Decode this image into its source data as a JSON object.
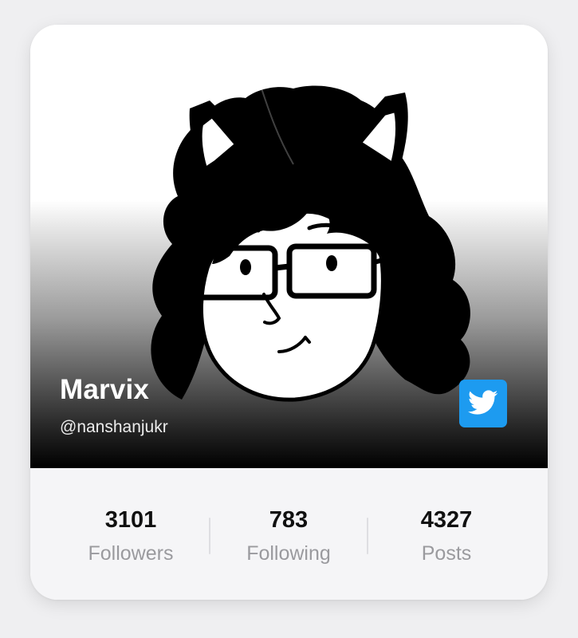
{
  "profile": {
    "name": "Marvix",
    "handle": "@nanshanjukr",
    "avatar_icon": "cat-ear-girl-with-glasses-illustration",
    "platform_icon": "twitter-bird-icon",
    "platform_color": "#1d9bf0"
  },
  "stats": [
    {
      "value": "3101",
      "label": "Followers"
    },
    {
      "value": "783",
      "label": "Following"
    },
    {
      "value": "4327",
      "label": "Posts"
    }
  ]
}
